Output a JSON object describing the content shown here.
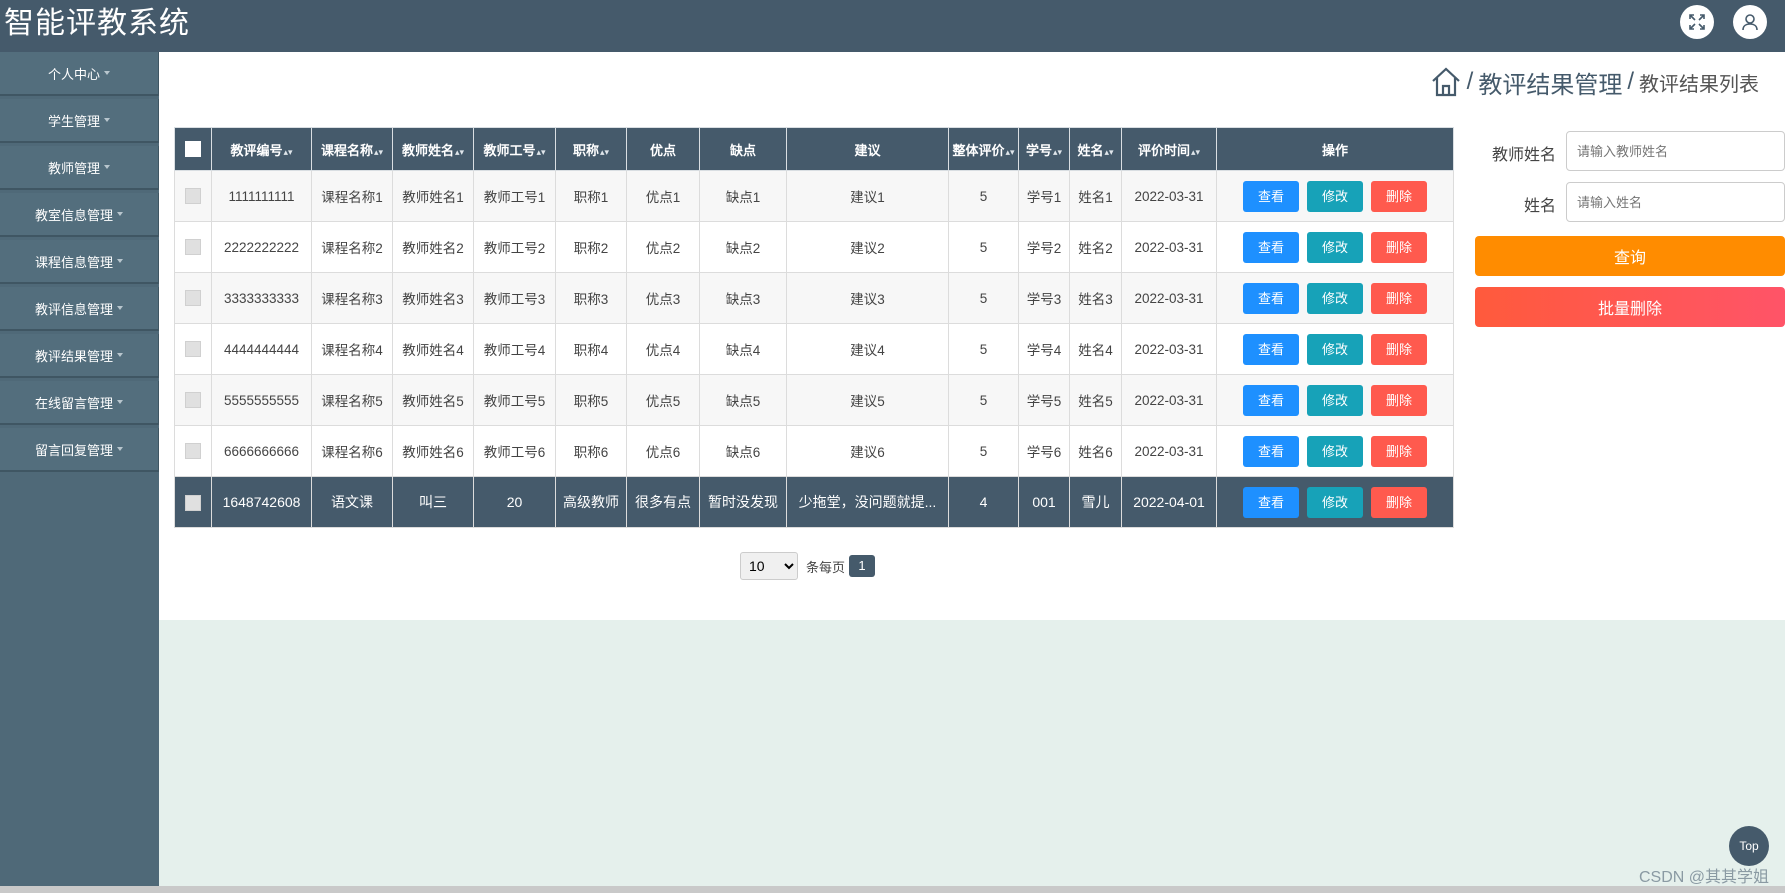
{
  "app": {
    "title": "智能评教系统"
  },
  "header": {
    "fullscreen_icon": "fullscreen-icon",
    "user_icon": "user-icon"
  },
  "sidebar": {
    "items": [
      {
        "label": "个人中心"
      },
      {
        "label": "学生管理"
      },
      {
        "label": "教师管理"
      },
      {
        "label": "教室信息管理"
      },
      {
        "label": "课程信息管理"
      },
      {
        "label": "教评信息管理"
      },
      {
        "label": "教评结果管理"
      },
      {
        "label": "在线留言管理"
      },
      {
        "label": "留言回复管理"
      }
    ]
  },
  "breadcrumb": {
    "home_icon": "home-icon",
    "sep": "/",
    "section": "教评结果管理",
    "page": "教评结果列表"
  },
  "table": {
    "headers": [
      "教评编号",
      "课程名称",
      "教师姓名",
      "教师工号",
      "职称",
      "优点",
      "缺点",
      "建议",
      "整体评价",
      "学号",
      "姓名",
      "评价时间",
      "操作"
    ],
    "rows": [
      [
        "1111111111",
        "课程名称1",
        "教师姓名1",
        "教师工号1",
        "职称1",
        "优点1",
        "缺点1",
        "建议1",
        "5",
        "学号1",
        "姓名1",
        "2022-03-31"
      ],
      [
        "2222222222",
        "课程名称2",
        "教师姓名2",
        "教师工号2",
        "职称2",
        "优点2",
        "缺点2",
        "建议2",
        "5",
        "学号2",
        "姓名2",
        "2022-03-31"
      ],
      [
        "3333333333",
        "课程名称3",
        "教师姓名3",
        "教师工号3",
        "职称3",
        "优点3",
        "缺点3",
        "建议3",
        "5",
        "学号3",
        "姓名3",
        "2022-03-31"
      ],
      [
        "4444444444",
        "课程名称4",
        "教师姓名4",
        "教师工号4",
        "职称4",
        "优点4",
        "缺点4",
        "建议4",
        "5",
        "学号4",
        "姓名4",
        "2022-03-31"
      ],
      [
        "5555555555",
        "课程名称5",
        "教师姓名5",
        "教师工号5",
        "职称5",
        "优点5",
        "缺点5",
        "建议5",
        "5",
        "学号5",
        "姓名5",
        "2022-03-31"
      ],
      [
        "6666666666",
        "课程名称6",
        "教师姓名6",
        "教师工号6",
        "职称6",
        "优点6",
        "缺点6",
        "建议6",
        "5",
        "学号6",
        "姓名6",
        "2022-03-31"
      ],
      [
        "1648742608",
        "语文课",
        "叫三",
        "20",
        "高级教师",
        "很多有点",
        "暂时没发现",
        "少拖堂，没问题就提...",
        "4",
        "001",
        "雪儿",
        "2022-04-01"
      ]
    ],
    "actions": {
      "view": "查看",
      "edit": "修改",
      "delete": "删除"
    }
  },
  "pagination": {
    "page_size": "10",
    "per_page_label": "条每页",
    "current_page": "1"
  },
  "search": {
    "teacher_label": "教师姓名",
    "teacher_placeholder": "请输入教师姓名",
    "name_label": "姓名",
    "name_placeholder": "请输入姓名",
    "query_button": "查询",
    "batch_delete_button": "批量删除"
  },
  "colors": {
    "header": "#455a6b",
    "query": "#ff8c00",
    "batch_delete": "#ff5a4e",
    "view": "#1e90ff",
    "edit": "#17a2b8",
    "delete": "#ff5a4e"
  },
  "scroll_top": {
    "label": "Top"
  },
  "watermark": "CSDN @其其学姐"
}
